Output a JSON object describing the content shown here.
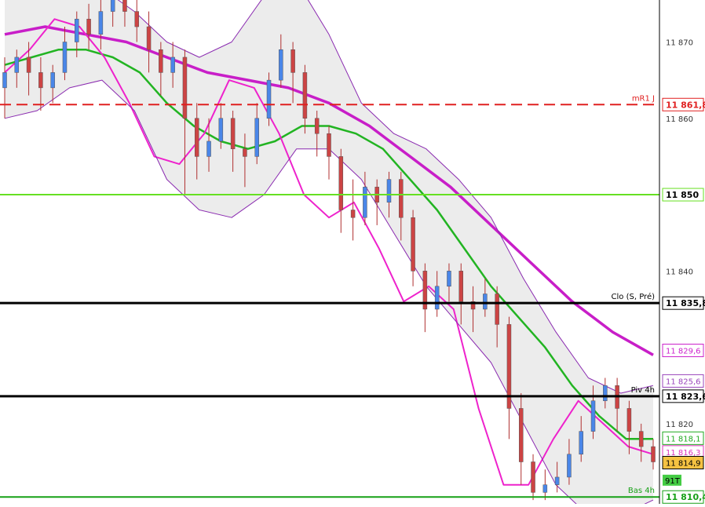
{
  "chart_data": {
    "type": "candlestick",
    "y_axis": {
      "ticks": [
        "11 870",
        "11 860",
        "11 850",
        "11 840",
        "11 820"
      ],
      "tick_values": [
        11870,
        11860,
        11850,
        11840,
        11820
      ],
      "ylim": [
        11809.5,
        11875.5
      ]
    },
    "horizontal_lines": [
      {
        "label": "mR1 J",
        "value": 11861.8,
        "tag": "11 861,8",
        "color": "#e02020",
        "dashed": true
      },
      {
        "label": "",
        "value": 11850,
        "tag": "11 850",
        "color": "#66e022",
        "dashed": false
      },
      {
        "label": "Clo (S, Pré)",
        "value": 11835.8,
        "tag": "11 835,8",
        "color": "#000000",
        "dashed": false
      },
      {
        "label": "Piv 4h",
        "value": 11823.6,
        "tag": "11 823,6",
        "color": "#000000",
        "dashed": false
      },
      {
        "label": "Bas 4h",
        "value": 11810.4,
        "tag": "11 810,4",
        "color": "#16a016",
        "dashed": false
      }
    ],
    "price_tags": [
      {
        "value": 11829.6,
        "text": "11 829,6",
        "color": "#cc22cc"
      },
      {
        "value": 11825.6,
        "text": "11 825,6",
        "color": "#9944bb"
      },
      {
        "value": 11818.1,
        "text": "11 818,1",
        "color": "#22aa22"
      },
      {
        "value": 11816.3,
        "text": "11 816,3",
        "color": "#dd33bb"
      },
      {
        "value": 11814.9,
        "text": "11 814,9",
        "color": "#000000",
        "bg": "#f5c242"
      }
    ],
    "counter_label": "91T",
    "candles": [
      [
        11864,
        11866,
        11860,
        11868
      ],
      [
        11866,
        11868,
        11864,
        11869
      ],
      [
        11868,
        11866,
        11863,
        11870
      ],
      [
        11866,
        11864,
        11861,
        11868
      ],
      [
        11864,
        11866,
        11862,
        11867
      ],
      [
        11866,
        11870,
        11865,
        11872
      ],
      [
        11870,
        11873,
        11868,
        11874
      ],
      [
        11873,
        11871,
        11869,
        11875
      ],
      [
        11871,
        11874,
        11869,
        11876
      ],
      [
        11874,
        11876,
        11872,
        11877
      ],
      [
        11876,
        11874,
        11872,
        11878
      ],
      [
        11874,
        11872,
        11870,
        11876
      ],
      [
        11872,
        11869,
        11866,
        11874
      ],
      [
        11869,
        11866,
        11863,
        11870
      ],
      [
        11866,
        11868,
        11864,
        11870
      ],
      [
        11868,
        11860,
        11850,
        11869
      ],
      [
        11860,
        11855,
        11852,
        11862
      ],
      [
        11855,
        11857,
        11853,
        11860
      ],
      [
        11857,
        11860,
        11856,
        11862
      ],
      [
        11860,
        11856,
        11853,
        11861
      ],
      [
        11856,
        11855,
        11851,
        11858
      ],
      [
        11855,
        11860,
        11854,
        11862
      ],
      [
        11860,
        11865,
        11859,
        11866
      ],
      [
        11865,
        11869,
        11864,
        11871
      ],
      [
        11869,
        11866,
        11862,
        11870
      ],
      [
        11866,
        11860,
        11858,
        11867
      ],
      [
        11860,
        11858,
        11855,
        11861
      ],
      [
        11858,
        11855,
        11852,
        11859
      ],
      [
        11855,
        11848,
        11845,
        11856
      ],
      [
        11848,
        11847,
        11844,
        11852
      ],
      [
        11847,
        11851,
        11846,
        11853
      ],
      [
        11851,
        11849,
        11846,
        11852
      ],
      [
        11849,
        11852,
        11847,
        11853
      ],
      [
        11852,
        11847,
        11844,
        11853
      ],
      [
        11847,
        11840,
        11838,
        11848
      ],
      [
        11840,
        11835,
        11832,
        11841
      ],
      [
        11835,
        11838,
        11834,
        11840
      ],
      [
        11838,
        11840,
        11836,
        11841
      ],
      [
        11840,
        11836,
        11833,
        11841
      ],
      [
        11836,
        11835,
        11832,
        11838
      ],
      [
        11835,
        11837,
        11834,
        11839
      ],
      [
        11837,
        11833,
        11830,
        11838
      ],
      [
        11833,
        11822,
        11818,
        11834
      ],
      [
        11822,
        11815,
        11812,
        11824
      ],
      [
        11815,
        11811,
        11810,
        11816
      ],
      [
        11811,
        11812,
        11810,
        11814
      ],
      [
        11812,
        11813,
        11811,
        11815
      ],
      [
        11813,
        11816,
        11812,
        11818
      ],
      [
        11816,
        11819,
        11815,
        11821
      ],
      [
        11819,
        11823,
        11818,
        11825
      ],
      [
        11823,
        11825,
        11822,
        11826
      ],
      [
        11825,
        11822,
        11819,
        11826
      ],
      [
        11822,
        11819,
        11816,
        11823
      ],
      [
        11819,
        11817,
        11815,
        11820
      ],
      [
        11817,
        11815,
        11814,
        11818
      ]
    ],
    "series": [
      {
        "color": "#22b422",
        "width": 2.5,
        "values": [
          11867,
          11868,
          11869,
          11869,
          11868,
          11866,
          11862,
          11859,
          11857,
          11856,
          11857,
          11859,
          11859,
          11858,
          11856,
          11852,
          11848,
          11843,
          11838,
          11834,
          11830,
          11825,
          11821,
          11818,
          11818
        ]
      },
      {
        "color": "#c81ec8",
        "width": 3.5,
        "values": [
          11871,
          11872,
          11871,
          11870,
          11868,
          11866,
          11865,
          11864,
          11862,
          11859,
          11855,
          11851,
          11846,
          11841,
          11836,
          11832,
          11829
        ]
      },
      {
        "color": "#ee22cc",
        "width": 2,
        "values": [
          11866,
          11869,
          11873,
          11872,
          11868,
          11862,
          11855,
          11854,
          11858,
          11865,
          11864,
          11858,
          11850,
          11847,
          11849,
          11843,
          11836,
          11838,
          11835,
          11822,
          11812,
          11812,
          11818,
          11823,
          11820,
          11817,
          11816
        ]
      },
      {
        "color": "#8a2ab0",
        "width": 1,
        "values": [
          11878,
          11879,
          11879,
          11877,
          11874,
          11870,
          11868,
          11870,
          11876,
          11878,
          11871,
          11862,
          11858,
          11856,
          11852,
          11847,
          11839,
          11832,
          11826,
          11824,
          11825
        ]
      },
      {
        "color": "#8a2ab0",
        "width": 1,
        "values": [
          11860,
          11861,
          11864,
          11865,
          11861,
          11852,
          11848,
          11847,
          11850,
          11856,
          11856,
          11852,
          11845,
          11838,
          11833,
          11828,
          11820,
          11812,
          11808,
          11808,
          11810
        ]
      }
    ]
  }
}
